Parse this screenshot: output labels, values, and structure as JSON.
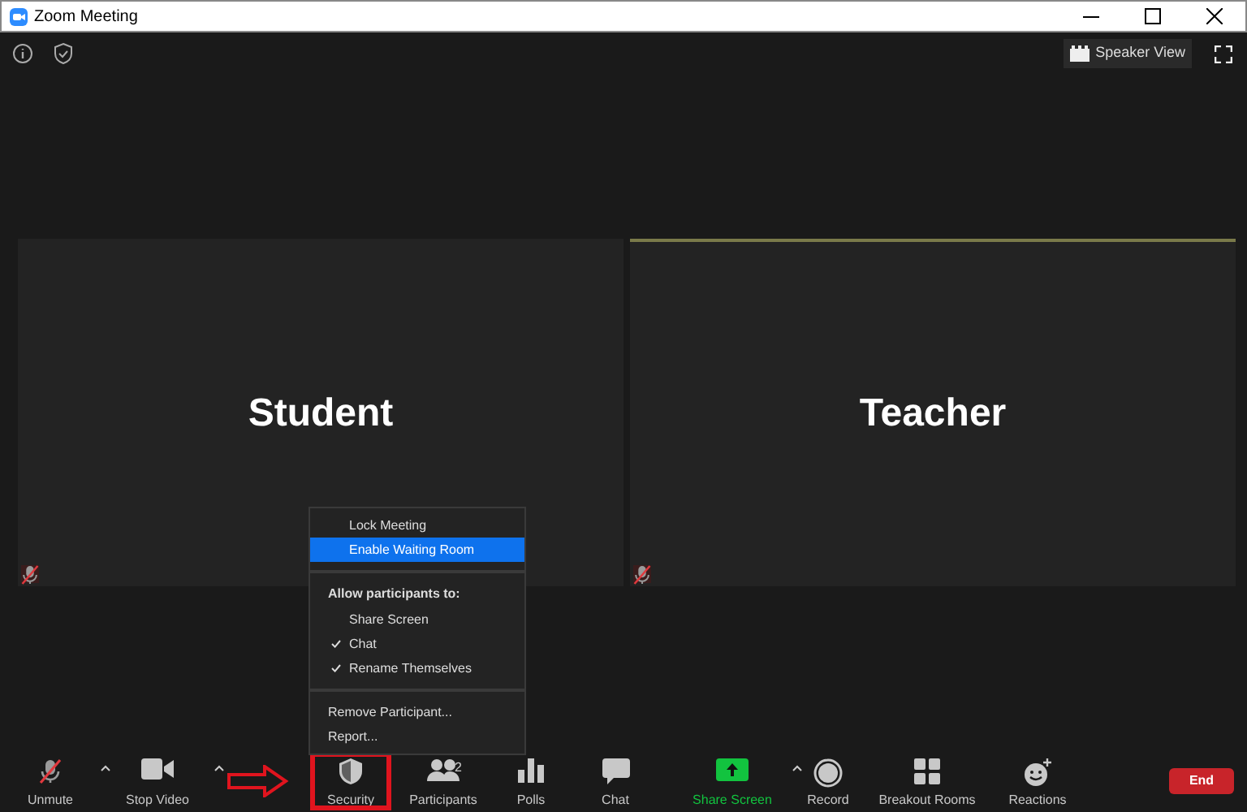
{
  "window": {
    "title": "Zoom Meeting"
  },
  "top_bar": {
    "view_button": "Speaker View"
  },
  "tiles": [
    {
      "name": "Student",
      "muted": true,
      "active": false
    },
    {
      "name": "Teacher",
      "muted": true,
      "active": true
    }
  ],
  "security_menu": {
    "items": [
      {
        "kind": "action",
        "label": "Lock Meeting",
        "selected": false
      },
      {
        "kind": "action",
        "label": "Enable Waiting Room",
        "selected": true
      },
      {
        "kind": "divider"
      },
      {
        "kind": "header",
        "label": "Allow participants to:"
      },
      {
        "kind": "toggle",
        "label": "Share Screen",
        "checked": false
      },
      {
        "kind": "toggle",
        "label": "Chat",
        "checked": true
      },
      {
        "kind": "toggle",
        "label": "Rename Themselves",
        "checked": true
      },
      {
        "kind": "divider"
      },
      {
        "kind": "plain",
        "label": "Remove Participant..."
      },
      {
        "kind": "plain",
        "label": "Report..."
      }
    ]
  },
  "toolbar": [
    {
      "kind": "mic",
      "label": "Unmute",
      "caret": true,
      "highlighted": false
    },
    {
      "kind": "video",
      "label": "Stop Video",
      "caret": true,
      "highlighted": false
    },
    {
      "kind": "security",
      "label": "Security",
      "caret": false,
      "highlighted": true
    },
    {
      "kind": "participants",
      "label": "Participants",
      "count": "2",
      "caret": false,
      "highlighted": false
    },
    {
      "kind": "polls",
      "label": "Polls",
      "caret": false,
      "highlighted": false
    },
    {
      "kind": "chat",
      "label": "Chat",
      "caret": false,
      "highlighted": false
    },
    {
      "kind": "share",
      "label": "Share Screen",
      "caret": true,
      "highlighted": false
    },
    {
      "kind": "record",
      "label": "Record",
      "caret": false,
      "highlighted": false
    },
    {
      "kind": "breakout",
      "label": "Breakout Rooms",
      "caret": false,
      "highlighted": false
    },
    {
      "kind": "reactions",
      "label": "Reactions",
      "caret": false,
      "highlighted": false
    }
  ],
  "end_button": "End"
}
